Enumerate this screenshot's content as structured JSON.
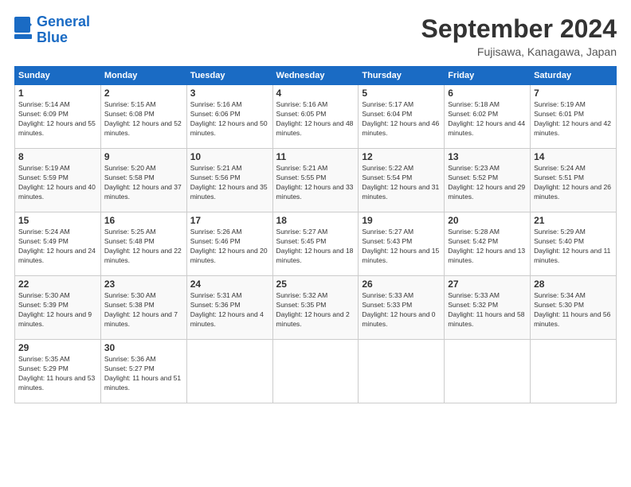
{
  "logo": {
    "line1": "General",
    "line2": "Blue"
  },
  "title": "September 2024",
  "location": "Fujisawa, Kanagawa, Japan",
  "days_of_week": [
    "Sunday",
    "Monday",
    "Tuesday",
    "Wednesday",
    "Thursday",
    "Friday",
    "Saturday"
  ],
  "weeks": [
    [
      {
        "day": "1",
        "sunrise": "5:14 AM",
        "sunset": "6:09 PM",
        "daylight": "12 hours and 55 minutes."
      },
      {
        "day": "2",
        "sunrise": "5:15 AM",
        "sunset": "6:08 PM",
        "daylight": "12 hours and 52 minutes."
      },
      {
        "day": "3",
        "sunrise": "5:16 AM",
        "sunset": "6:06 PM",
        "daylight": "12 hours and 50 minutes."
      },
      {
        "day": "4",
        "sunrise": "5:16 AM",
        "sunset": "6:05 PM",
        "daylight": "12 hours and 48 minutes."
      },
      {
        "day": "5",
        "sunrise": "5:17 AM",
        "sunset": "6:04 PM",
        "daylight": "12 hours and 46 minutes."
      },
      {
        "day": "6",
        "sunrise": "5:18 AM",
        "sunset": "6:02 PM",
        "daylight": "12 hours and 44 minutes."
      },
      {
        "day": "7",
        "sunrise": "5:19 AM",
        "sunset": "6:01 PM",
        "daylight": "12 hours and 42 minutes."
      }
    ],
    [
      {
        "day": "8",
        "sunrise": "5:19 AM",
        "sunset": "5:59 PM",
        "daylight": "12 hours and 40 minutes."
      },
      {
        "day": "9",
        "sunrise": "5:20 AM",
        "sunset": "5:58 PM",
        "daylight": "12 hours and 37 minutes."
      },
      {
        "day": "10",
        "sunrise": "5:21 AM",
        "sunset": "5:56 PM",
        "daylight": "12 hours and 35 minutes."
      },
      {
        "day": "11",
        "sunrise": "5:21 AM",
        "sunset": "5:55 PM",
        "daylight": "12 hours and 33 minutes."
      },
      {
        "day": "12",
        "sunrise": "5:22 AM",
        "sunset": "5:54 PM",
        "daylight": "12 hours and 31 minutes."
      },
      {
        "day": "13",
        "sunrise": "5:23 AM",
        "sunset": "5:52 PM",
        "daylight": "12 hours and 29 minutes."
      },
      {
        "day": "14",
        "sunrise": "5:24 AM",
        "sunset": "5:51 PM",
        "daylight": "12 hours and 26 minutes."
      }
    ],
    [
      {
        "day": "15",
        "sunrise": "5:24 AM",
        "sunset": "5:49 PM",
        "daylight": "12 hours and 24 minutes."
      },
      {
        "day": "16",
        "sunrise": "5:25 AM",
        "sunset": "5:48 PM",
        "daylight": "12 hours and 22 minutes."
      },
      {
        "day": "17",
        "sunrise": "5:26 AM",
        "sunset": "5:46 PM",
        "daylight": "12 hours and 20 minutes."
      },
      {
        "day": "18",
        "sunrise": "5:27 AM",
        "sunset": "5:45 PM",
        "daylight": "12 hours and 18 minutes."
      },
      {
        "day": "19",
        "sunrise": "5:27 AM",
        "sunset": "5:43 PM",
        "daylight": "12 hours and 15 minutes."
      },
      {
        "day": "20",
        "sunrise": "5:28 AM",
        "sunset": "5:42 PM",
        "daylight": "12 hours and 13 minutes."
      },
      {
        "day": "21",
        "sunrise": "5:29 AM",
        "sunset": "5:40 PM",
        "daylight": "12 hours and 11 minutes."
      }
    ],
    [
      {
        "day": "22",
        "sunrise": "5:30 AM",
        "sunset": "5:39 PM",
        "daylight": "12 hours and 9 minutes."
      },
      {
        "day": "23",
        "sunrise": "5:30 AM",
        "sunset": "5:38 PM",
        "daylight": "12 hours and 7 minutes."
      },
      {
        "day": "24",
        "sunrise": "5:31 AM",
        "sunset": "5:36 PM",
        "daylight": "12 hours and 4 minutes."
      },
      {
        "day": "25",
        "sunrise": "5:32 AM",
        "sunset": "5:35 PM",
        "daylight": "12 hours and 2 minutes."
      },
      {
        "day": "26",
        "sunrise": "5:33 AM",
        "sunset": "5:33 PM",
        "daylight": "12 hours and 0 minutes."
      },
      {
        "day": "27",
        "sunrise": "5:33 AM",
        "sunset": "5:32 PM",
        "daylight": "11 hours and 58 minutes."
      },
      {
        "day": "28",
        "sunrise": "5:34 AM",
        "sunset": "5:30 PM",
        "daylight": "11 hours and 56 minutes."
      }
    ],
    [
      {
        "day": "29",
        "sunrise": "5:35 AM",
        "sunset": "5:29 PM",
        "daylight": "11 hours and 53 minutes."
      },
      {
        "day": "30",
        "sunrise": "5:36 AM",
        "sunset": "5:27 PM",
        "daylight": "11 hours and 51 minutes."
      },
      null,
      null,
      null,
      null,
      null
    ]
  ]
}
